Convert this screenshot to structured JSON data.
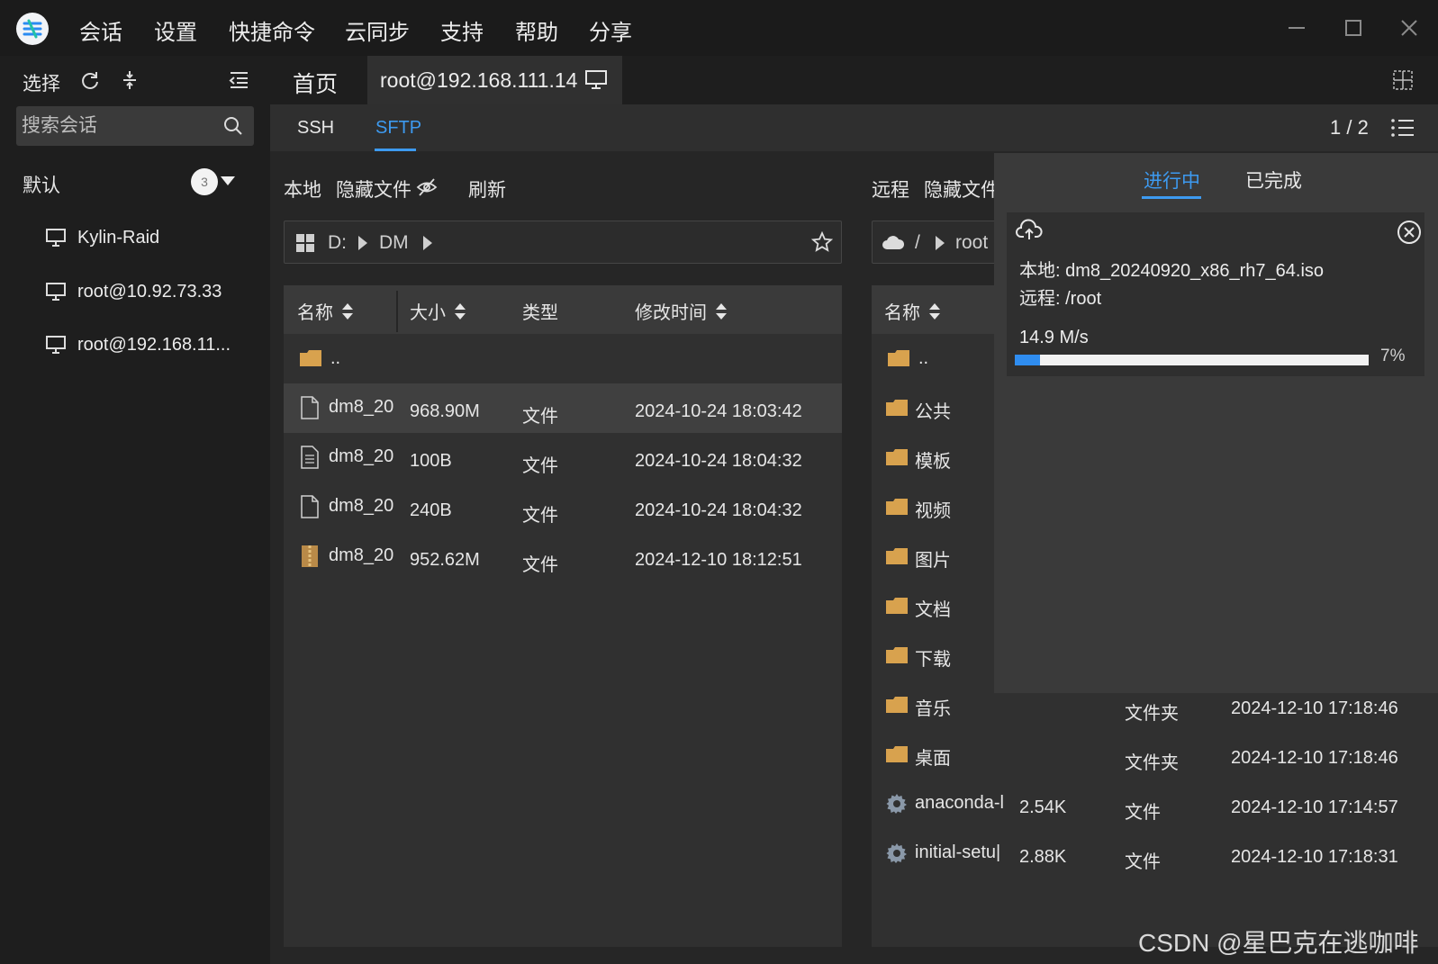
{
  "titlebar": {
    "menu": [
      "会话",
      "设置",
      "快捷命令",
      "云同步",
      "支持",
      "帮助",
      "分享"
    ]
  },
  "sidebar": {
    "select_label": "选择",
    "search_placeholder": "搜索会话",
    "group": {
      "label": "默认",
      "count": "3"
    },
    "sessions": [
      {
        "label": "Kylin-Raid",
        "icon": "monitor-icon"
      },
      {
        "label": "root@10.92.73.33",
        "icon": "monitor-icon"
      },
      {
        "label": "root@192.168.11...",
        "icon": "monitor-icon"
      }
    ]
  },
  "tabs": {
    "home": "首页",
    "connection": "root@192.168.111.14"
  },
  "subtabs": {
    "ssh": "SSH",
    "sftp": "SFTP",
    "active": "SFTP"
  },
  "pager": "1 / 2",
  "local": {
    "title": "本地",
    "hidden_files": "隐藏文件",
    "refresh": "刷新",
    "path": [
      "D:",
      "DM"
    ],
    "columns": [
      "名称",
      "大小",
      "类型",
      "修改时间"
    ],
    "parent": "..",
    "files": [
      {
        "name": "dm8_20",
        "size": "968.90M",
        "type": "文件",
        "mtime": "2024-10-24 18:03:42",
        "icon": "file-icon"
      },
      {
        "name": "dm8_20",
        "size": "100B",
        "type": "文件",
        "mtime": "2024-10-24 18:04:32",
        "icon": "text-file-icon"
      },
      {
        "name": "dm8_20",
        "size": "240B",
        "type": "文件",
        "mtime": "2024-10-24 18:04:32",
        "icon": "file-icon"
      },
      {
        "name": "dm8_20",
        "size": "952.62M",
        "type": "文件",
        "mtime": "2024-12-10 18:12:51",
        "icon": "archive-icon"
      }
    ]
  },
  "remote": {
    "title": "远程",
    "hidden_files": "隐藏文件",
    "path": [
      "/",
      "root"
    ],
    "columns": [
      "名称"
    ],
    "parent": "..",
    "files": [
      {
        "name": "公共",
        "size": "",
        "type": "",
        "mtime": "",
        "icon": "folder-icon"
      },
      {
        "name": "模板",
        "size": "",
        "type": "",
        "mtime": "",
        "icon": "folder-icon"
      },
      {
        "name": "视频",
        "size": "",
        "type": "",
        "mtime": "",
        "icon": "folder-icon"
      },
      {
        "name": "图片",
        "size": "",
        "type": "",
        "mtime": "",
        "icon": "folder-icon"
      },
      {
        "name": "文档",
        "size": "",
        "type": "",
        "mtime": "",
        "icon": "folder-icon"
      },
      {
        "name": "下载",
        "size": "",
        "type": "",
        "mtime": "",
        "icon": "folder-icon"
      },
      {
        "name": "音乐",
        "size": "",
        "type": "文件夹",
        "mtime": "2024-12-10 17:18:46",
        "icon": "folder-icon"
      },
      {
        "name": "桌面",
        "size": "",
        "type": "文件夹",
        "mtime": "2024-12-10 17:18:46",
        "icon": "folder-icon"
      },
      {
        "name": "anaconda-l",
        "size": "2.54K",
        "type": "文件",
        "mtime": "2024-12-10 17:14:57",
        "icon": "gear-icon"
      },
      {
        "name": "initial-setu|",
        "size": "2.88K",
        "type": "文件",
        "mtime": "2024-12-10 17:18:31",
        "icon": "gear-icon"
      }
    ]
  },
  "transfer": {
    "tab_active": "进行中",
    "tab_done": "已完成",
    "local_line": "本地: dm8_20240920_x86_rh7_64.iso",
    "remote_line": "远程: /root",
    "speed": "14.9 M/s",
    "percent_label": "7%",
    "progress": 0.07
  },
  "watermark": "CSDN @星巴克在逃咖啡",
  "colors": {
    "accent": "#3d9af0",
    "folder": "#d8a24e",
    "background": "#1e1e1e"
  }
}
